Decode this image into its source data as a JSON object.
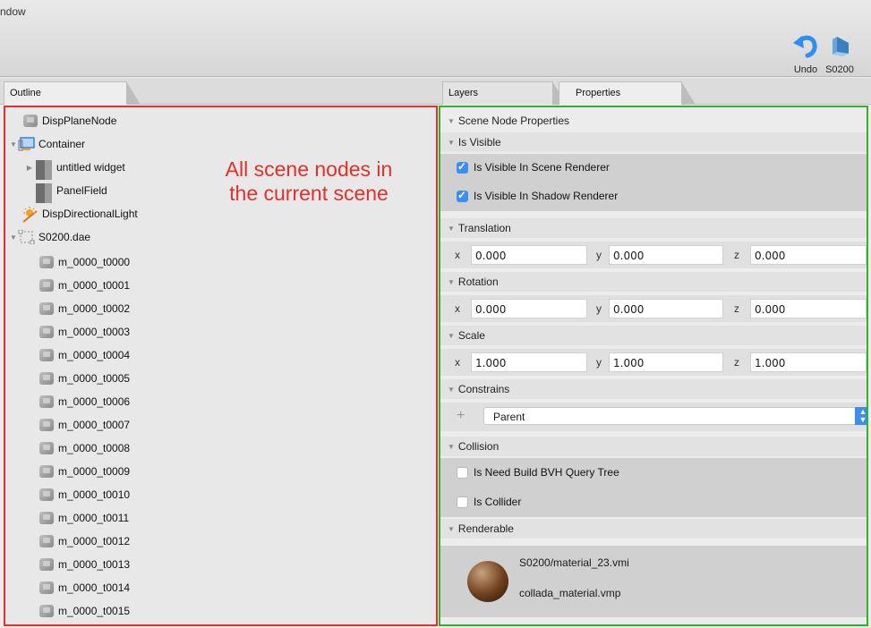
{
  "window": {
    "title": "ndow"
  },
  "toolbar": {
    "undo_label": "Undo",
    "scene_label": "S0200",
    "accent": "#3b8ff0"
  },
  "tabs_left": [
    {
      "label": "Outline"
    }
  ],
  "tabs_right": [
    {
      "label": "Layers"
    },
    {
      "label": "Properties"
    }
  ],
  "annotations": {
    "outline_note_line1": "All scene nodes in",
    "outline_note_line2": "the current scene",
    "outline_color": "#e0312b",
    "props_color": "#36b02c"
  },
  "outline": {
    "items": [
      {
        "label": "DispPlaneNode",
        "icon": "mesh-node-icon"
      },
      {
        "label": "Container",
        "icon": "container-icon"
      },
      {
        "label": "untitled widget",
        "icon": "widget-icon"
      },
      {
        "label": "PanelField",
        "icon": "panel-icon"
      },
      {
        "label": "DispDirectionalLight",
        "icon": "light-icon"
      },
      {
        "label": "S0200.dae",
        "icon": "scene-file-icon"
      },
      {
        "label": "m_0000_t0000",
        "icon": "mesh-node-icon"
      },
      {
        "label": "m_0000_t0001",
        "icon": "mesh-node-icon"
      },
      {
        "label": "m_0000_t0002",
        "icon": "mesh-node-icon"
      },
      {
        "label": "m_0000_t0003",
        "icon": "mesh-node-icon"
      },
      {
        "label": "m_0000_t0004",
        "icon": "mesh-node-icon"
      },
      {
        "label": "m_0000_t0005",
        "icon": "mesh-node-icon"
      },
      {
        "label": "m_0000_t0006",
        "icon": "mesh-node-icon"
      },
      {
        "label": "m_0000_t0007",
        "icon": "mesh-node-icon"
      },
      {
        "label": "m_0000_t0008",
        "icon": "mesh-node-icon"
      },
      {
        "label": "m_0000_t0009",
        "icon": "mesh-node-icon"
      },
      {
        "label": "m_0000_t0010",
        "icon": "mesh-node-icon"
      },
      {
        "label": "m_0000_t0011",
        "icon": "mesh-node-icon"
      },
      {
        "label": "m_0000_t0012",
        "icon": "mesh-node-icon"
      },
      {
        "label": "m_0000_t0013",
        "icon": "mesh-node-icon"
      },
      {
        "label": "m_0000_t0014",
        "icon": "mesh-node-icon"
      },
      {
        "label": "m_0000_t0015",
        "icon": "mesh-node-icon"
      }
    ]
  },
  "properties": {
    "header": "Scene Node Properties",
    "visible_section": "Is Visible",
    "visible_scene": {
      "label": "Is Visible In Scene Renderer",
      "checked": true
    },
    "visible_shadow": {
      "label": "Is Visible In Shadow Renderer",
      "checked": true
    },
    "translation": {
      "title": "Translation",
      "x": "0.000",
      "y": "0.000",
      "z": "0.000"
    },
    "rotation": {
      "title": "Rotation",
      "x": "0.000",
      "y": "0.000",
      "z": "0.000"
    },
    "scale": {
      "title": "Scale",
      "x": "1.000",
      "y": "1.000",
      "z": "1.000"
    },
    "axis_labels": {
      "x": "x",
      "y": "y",
      "z": "z"
    },
    "constrains": {
      "title": "Constrains",
      "add_symbol": "+",
      "selected": "Parent"
    },
    "collision": {
      "title": "Collision",
      "bvh": {
        "label": "Is Need Build BVH Query Tree",
        "checked": false
      },
      "collider": {
        "label": "Is Collider",
        "checked": false
      }
    },
    "renderable": {
      "title": "Renderable",
      "material": "S0200/material_23.vmi",
      "program": "collada_material.vmp"
    }
  }
}
